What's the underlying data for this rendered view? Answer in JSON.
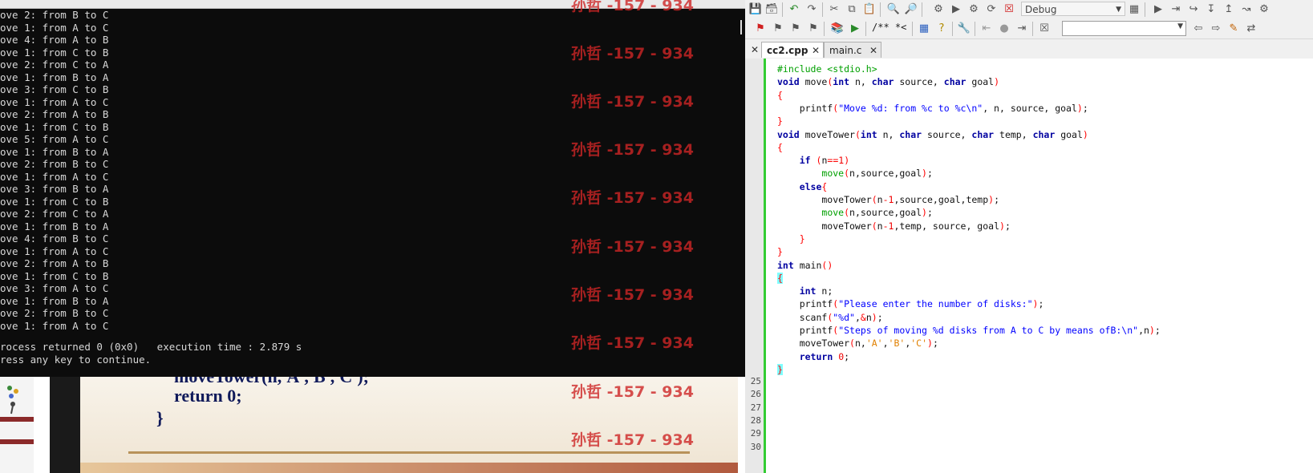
{
  "console": {
    "lines": [
      "ove 2: from B to C",
      "ove 1: from A to C",
      "ove 4: from A to B",
      "ove 1: from C to B",
      "ove 2: from C to A",
      "ove 1: from B to A",
      "ove 3: from C to B",
      "ove 1: from A to C",
      "ove 2: from A to B",
      "ove 1: from C to B",
      "ove 5: from A to C",
      "ove 1: from B to A",
      "ove 2: from B to C",
      "ove 1: from A to C",
      "ove 3: from B to A",
      "ove 1: from C to B",
      "ove 2: from C to A",
      "ove 1: from B to A",
      "ove 4: from B to C",
      "ove 1: from A to C",
      "ove 2: from A to B",
      "ove 1: from C to B",
      "ove 3: from A to C",
      "ove 1: from B to A",
      "ove 2: from B to C",
      "ove 1: from A to C"
    ],
    "status_line_1": "rocess returned 0 (0x0)   execution time : 2.879 s",
    "status_line_2": "ress any key to continue."
  },
  "watermark": {
    "text": "孙哲 -157 - 934",
    "color": "#cd2626"
  },
  "slide": {
    "code_line_1": "moveTower(n,'A','B','C');",
    "code_line_2": "return 0;",
    "code_line_3": "}"
  },
  "ide": {
    "build_target": "Debug",
    "comment_tool_label": "/** *<",
    "tabs": [
      {
        "label": "cc2.cpp",
        "active": true
      },
      {
        "label": "main.c",
        "active": false
      }
    ],
    "visible_line_numbers": [
      "25",
      "26",
      "27",
      "28",
      "29",
      "30"
    ]
  },
  "code": [
    "#include <stdio.h>",
    "void move(int n, char source, char goal)",
    "{",
    "    printf(\"Move %d: from %c to %c\\n\", n, source, goal);",
    "}",
    "void moveTower(int n, char source, char temp, char goal)",
    "{",
    "    if (n==1)",
    "        move(n,source,goal);",
    "    else{",
    "        moveTower(n-1,source,goal,temp);",
    "        move(n,source,goal);",
    "        moveTower(n-1,temp, source, goal);",
    "    }",
    "}",
    "int main()",
    "{",
    "    int n;",
    "    printf(\"Please enter the number of disks:\");",
    "    scanf(\"%d\",&n);",
    "    printf(\"Steps of moving %d disks from A to C by means ofB:\\n\",n);",
    "    moveTower(n,'A','B','C');",
    "    return 0;",
    "}"
  ]
}
